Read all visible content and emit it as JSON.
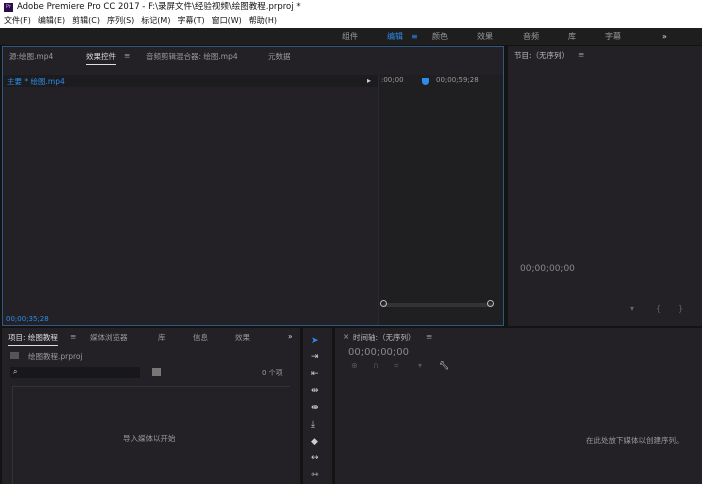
{
  "window": {
    "title": "Adobe Premiere Pro CC 2017 - F:\\录屏文件\\经验视频\\绘图教程.prproj *",
    "icon": "Pr"
  },
  "menu": [
    "文件(F)",
    "编辑(E)",
    "剪辑(C)",
    "序列(S)",
    "标记(M)",
    "字幕(T)",
    "窗口(W)",
    "帮助(H)"
  ],
  "workspaces": {
    "items": [
      "组件",
      "编辑",
      "颜色",
      "效果",
      "音频",
      "库",
      "字幕"
    ],
    "active": "编辑",
    "more": "»",
    "menu": "≡"
  },
  "effects_panel": {
    "tabs": [
      "源:绘图.mp4",
      "效果控件",
      "音频剪辑混合器: 绘图.mp4",
      "元数据"
    ],
    "active_tab": "效果控件",
    "menu": "≡",
    "clip_label": "主要 * 绘图.mp4",
    "time_start": ":00;00",
    "time_end": "00;00;59;28",
    "current_time": "00;00;35;28"
  },
  "program_panel": {
    "title": "节目:（无序列）",
    "menu": "≡",
    "timecode": "00;00;00;00"
  },
  "project_panel": {
    "tabs": [
      "项目: 绘图教程",
      "媒体浏览器",
      "库",
      "信息",
      "效果"
    ],
    "menu": "≡",
    "more": "»",
    "file": "绘图教程.prproj",
    "item_count": "0 个项",
    "empty_text": "导入媒体以开始"
  },
  "timeline_panel": {
    "title": "时间轴:（无序列）",
    "menu": "≡",
    "close": "×",
    "timecode": "00;00;00;00",
    "empty_text": "在此处放下媒体以创建序列。"
  },
  "colors": {
    "accent": "#2d8ceb",
    "panel": "#232125"
  }
}
